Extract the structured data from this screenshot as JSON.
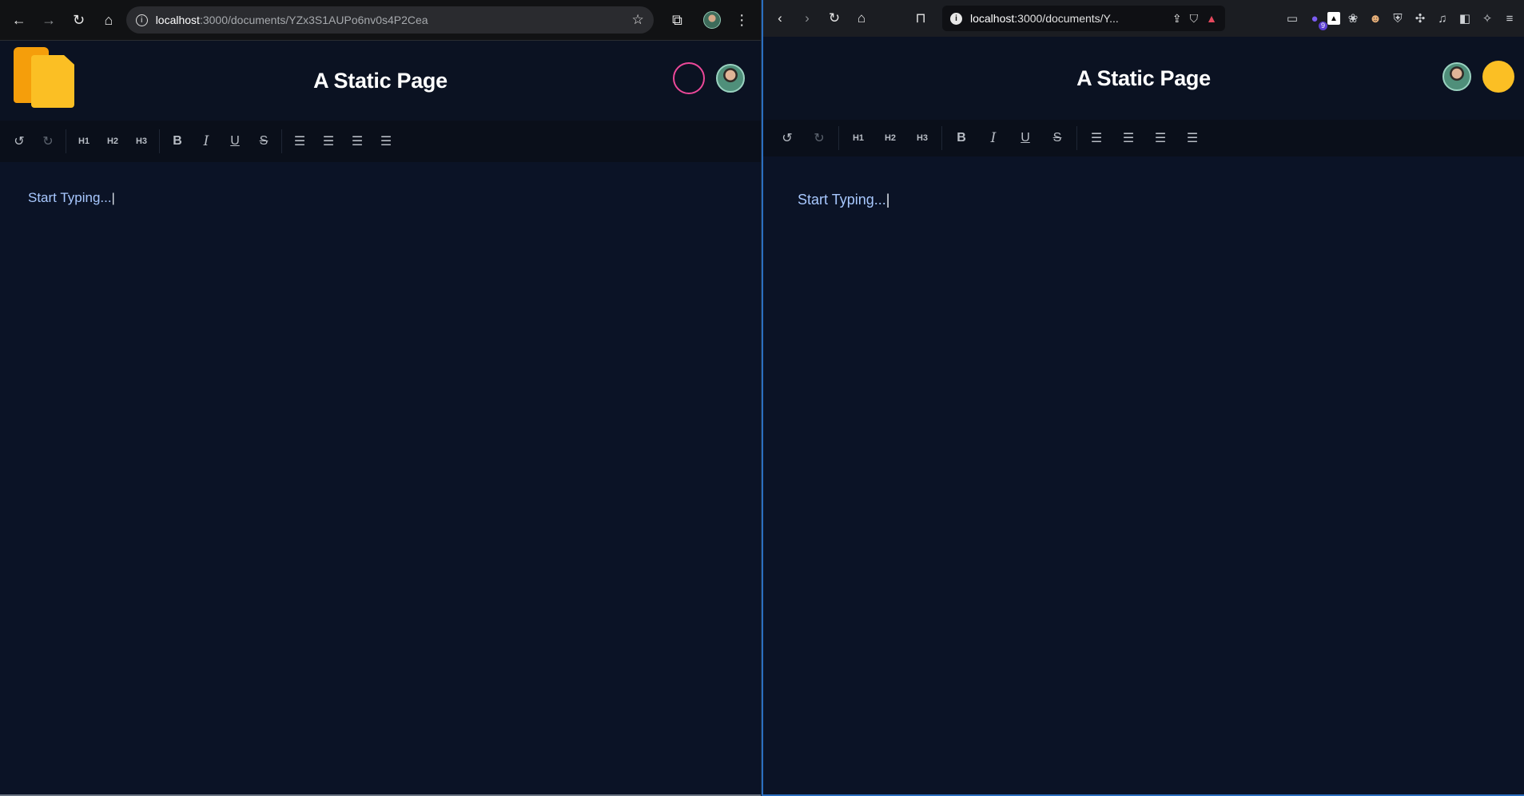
{
  "left_window": {
    "url_host": "localhost",
    "url_path": ":3000/documents/YZx3S1AUPo6nv0s4P2Cea",
    "page_title": "A Static Page",
    "toolbar": {
      "h1": "H1",
      "h2": "H2",
      "h3": "H3",
      "bold": "B",
      "italic": "I",
      "underline": "U",
      "strike": "S"
    },
    "editor_placeholder": "Start Typing...",
    "colors": {
      "ring": "#ec4899",
      "logo_back": "#f59e0b",
      "logo_front": "#fbbf24"
    }
  },
  "right_window": {
    "url_host": "localhost",
    "url_path": ":3000/documents/Y...",
    "extension_badge": "9",
    "page_title": "A Static Page",
    "toolbar": {
      "h1": "H1",
      "h2": "H2",
      "h3": "H3",
      "bold": "B",
      "italic": "I",
      "underline": "U",
      "strike": "S"
    },
    "editor_placeholder": "Start Typing...",
    "colors": {
      "user_dot": "#fbbf24",
      "active_border": "#2b6fc0"
    }
  },
  "caret": "|"
}
